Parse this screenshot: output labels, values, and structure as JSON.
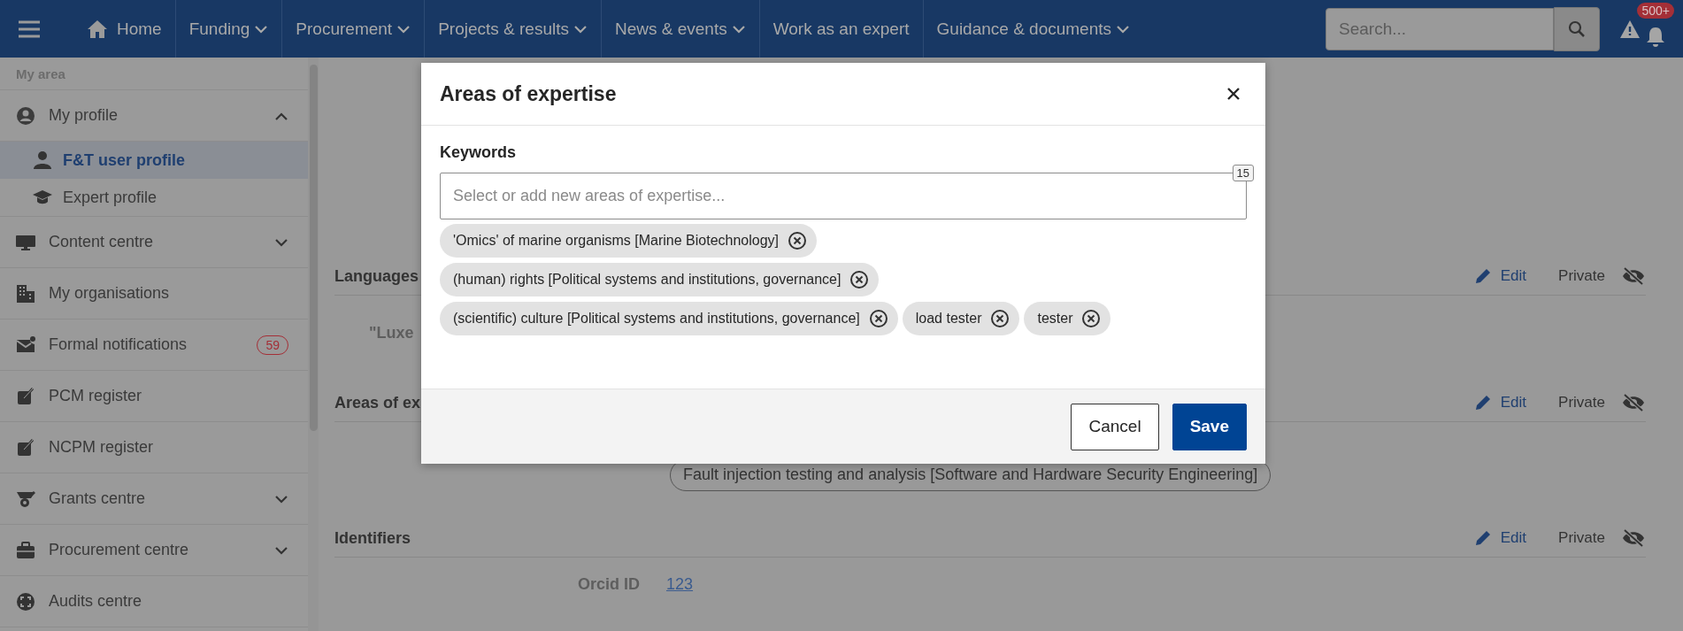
{
  "top_nav": {
    "home": "Home",
    "items": [
      {
        "label": "Funding",
        "has_menu": true
      },
      {
        "label": "Procurement",
        "has_menu": true
      },
      {
        "label": "Projects & results",
        "has_menu": true
      },
      {
        "label": "News & events",
        "has_menu": true
      },
      {
        "label": "Work as an expert",
        "has_menu": false
      },
      {
        "label": "Guidance & documents",
        "has_menu": true
      }
    ],
    "search": {
      "placeholder": "Search..."
    },
    "notifications_badge": "500+"
  },
  "sidebar": {
    "title": "My area",
    "items": [
      {
        "label": "My profile",
        "expanded": true,
        "selected": false,
        "children": [
          {
            "label": "F&T user profile",
            "selected": true
          },
          {
            "label": "Expert profile",
            "selected": false
          }
        ]
      },
      {
        "label": "Content centre",
        "expanded": false,
        "selected": false
      },
      {
        "label": "My organisations",
        "selected": false
      },
      {
        "label": "Formal notifications",
        "selected": false,
        "badge": "59"
      },
      {
        "label": "PCM register",
        "selected": false
      },
      {
        "label": "NCPM register",
        "selected": false
      },
      {
        "label": "Grants centre",
        "expanded": false,
        "selected": false
      },
      {
        "label": "Procurement centre",
        "expanded": false,
        "selected": false
      },
      {
        "label": "Audits centre",
        "selected": false
      }
    ]
  },
  "sections": [
    {
      "title": "Languages",
      "edit": "Edit",
      "visibility": "Private",
      "content": {
        "kind": "text",
        "value": "\"Luxe"
      }
    },
    {
      "title": "Areas of ex",
      "edit": "Edit",
      "visibility": "Private",
      "content": {
        "kind": "chip",
        "value": "Fault injection testing and analysis [Software and Hardware Security Engineering]"
      }
    },
    {
      "title": "Identifiers",
      "edit": "Edit",
      "visibility": "Private",
      "content": {
        "kind": "field",
        "label": "Orcid ID",
        "value": "123"
      }
    }
  ],
  "modal": {
    "title": "Areas of expertise",
    "field_label": "Keywords",
    "placeholder": "Select or add new areas of expertise...",
    "counter": "15",
    "chips": [
      "'Omics' of marine organisms [Marine Biotechnology]",
      "(human) rights [Political systems and institutions, governance]",
      "(scientific) culture [Political systems and institutions, governance]",
      "load tester",
      "tester"
    ],
    "buttons": [
      {
        "label": "Cancel",
        "kind": "secondary"
      },
      {
        "label": "Save",
        "kind": "primary"
      }
    ]
  }
}
